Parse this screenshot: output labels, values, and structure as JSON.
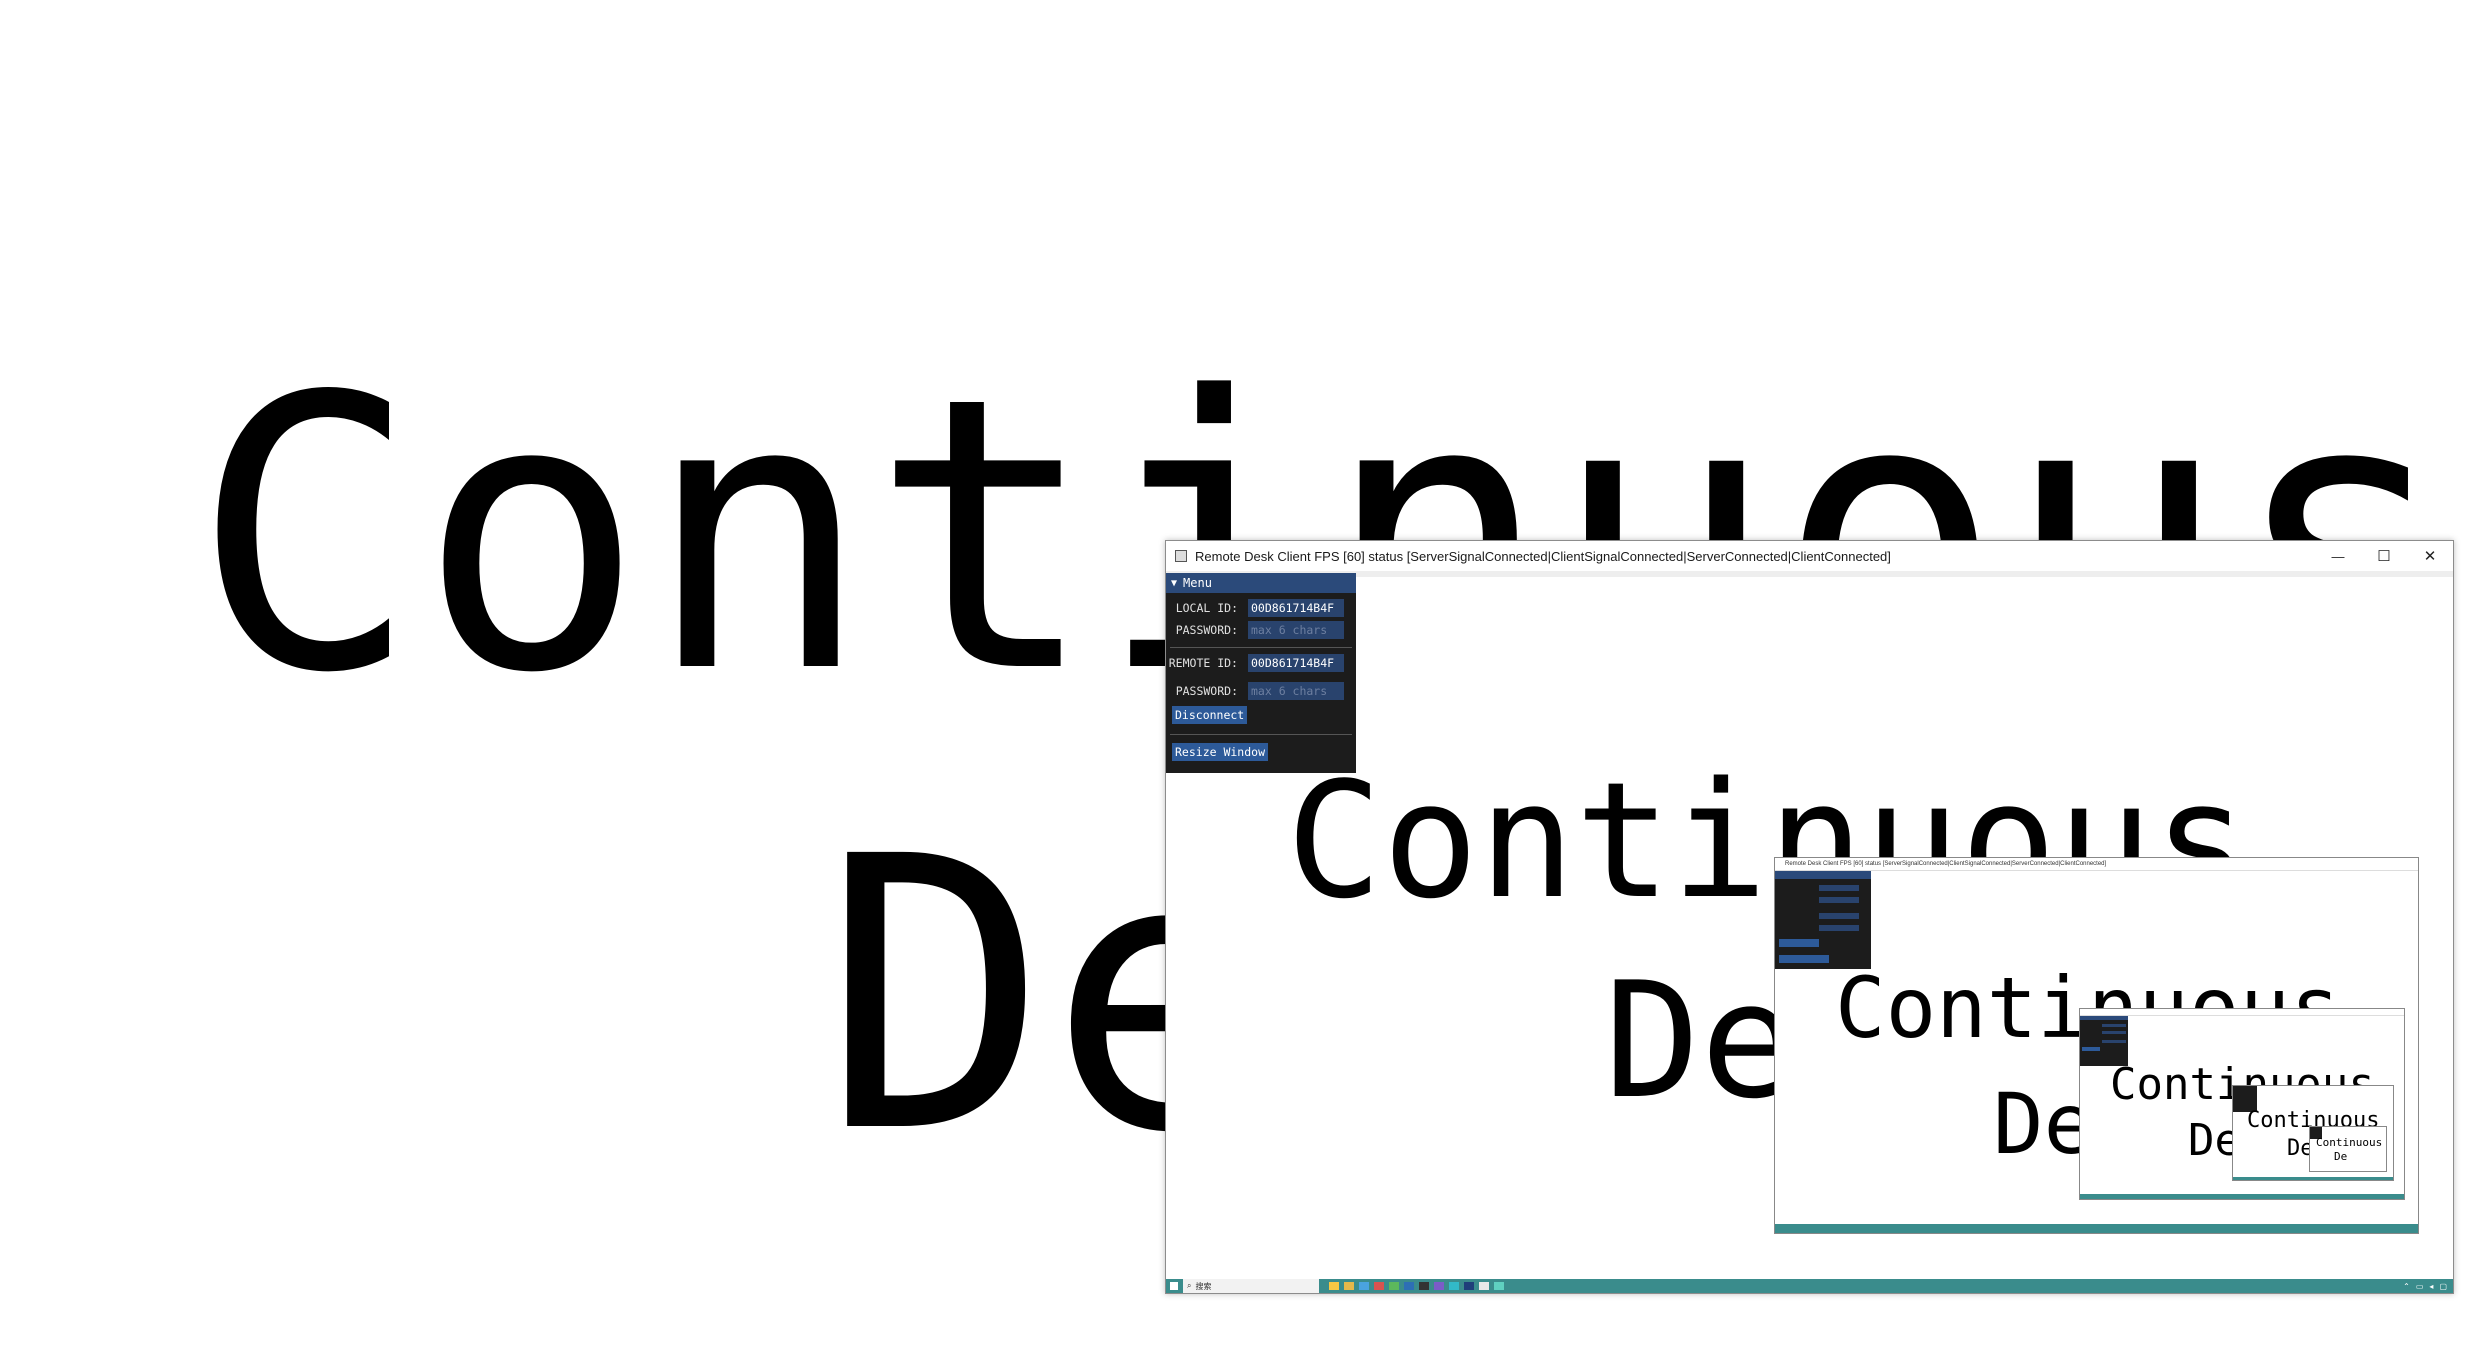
{
  "background_text": {
    "line1": "Continuous",
    "line2": "De"
  },
  "window": {
    "title": "Remote Desk Client FPS [60] status [ServerSignalConnected|ClientSignalConnected|ServerConnected|ClientConnected]",
    "minimize_label": "—",
    "maximize_label": "☐",
    "close_label": "✕"
  },
  "menu": {
    "header": "Menu",
    "local_id_label": "LOCAL ID:",
    "local_id_value": "00D861714B4F",
    "local_password_label": "PASSWORD:",
    "local_password_placeholder": "max 6 chars",
    "remote_id_label": "REMOTE ID:",
    "remote_id_value": "00D861714B4F",
    "remote_password_label": "PASSWORD:",
    "remote_password_placeholder": "max 6 chars",
    "disconnect_label": "Disconnect",
    "resize_label": "Resize Window"
  },
  "taskbar": {
    "search_placeholder": "搜索",
    "start_icon": "windows-logo-icon"
  },
  "colors": {
    "menu_bg": "#1c1c1c",
    "menu_header": "#2b4a7a",
    "button": "#2d5a99",
    "taskbar": "#3a8c8c"
  }
}
